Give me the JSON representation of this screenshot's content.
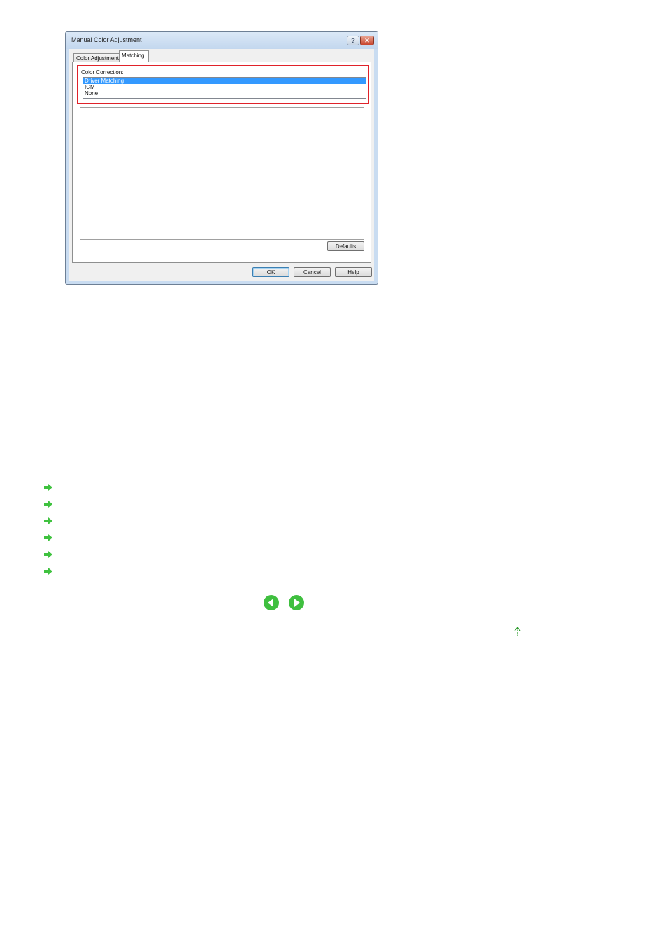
{
  "dialog": {
    "title": "Manual Color Adjustment",
    "help_button": "?",
    "close_button": "✕",
    "tabs": [
      {
        "label": "Color Adjustment",
        "active": false
      },
      {
        "label": "Matching",
        "active": true
      }
    ],
    "color_correction": {
      "label": "Color Correction:",
      "options": [
        "Driver Matching",
        "ICM",
        "None"
      ],
      "selected": "Driver Matching"
    },
    "defaults_button": "Defaults",
    "ok_button": "OK",
    "cancel_button": "Cancel",
    "help_button_label": "Help"
  },
  "colors": {
    "highlight_border": "#e0222a",
    "selection": "#3399ff",
    "arrow_green": "#3fc23f"
  },
  "link_list": {
    "icons": [
      "arrow-right-icon",
      "arrow-right-icon",
      "arrow-right-icon",
      "arrow-right-icon",
      "arrow-right-icon",
      "arrow-right-icon"
    ]
  },
  "navigation": {
    "prev_icon": "previous-page-icon",
    "next_icon": "next-page-icon",
    "top_icon": "page-top-icon"
  }
}
